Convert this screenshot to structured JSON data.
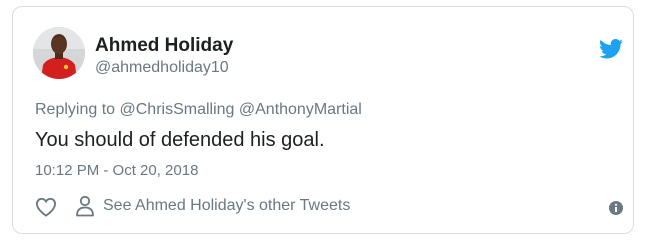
{
  "tweet": {
    "author_name": "Ahmed Holiday",
    "author_handle": "@ahmedholiday10",
    "replying_to": "Replying to @ChrisSmalling @AnthonyMartial",
    "text": "You should of defended his goal.",
    "timestamp": "10:12 PM - Oct 20, 2018",
    "other_tweets_link": "See Ahmed Holiday's other Tweets"
  },
  "icons": {
    "brand": "twitter-bird-icon",
    "like": "heart-icon",
    "profile": "person-icon",
    "info": "info-icon"
  },
  "colors": {
    "twitter_blue": "#1da1f2",
    "text": "#1c2022",
    "secondary_text": "#697882",
    "border": "#d9dde0"
  }
}
